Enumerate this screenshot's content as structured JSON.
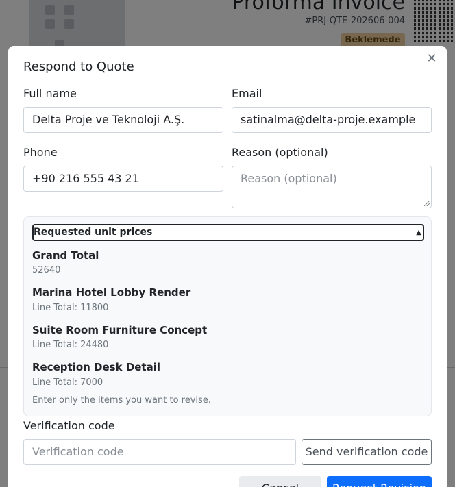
{
  "background": {
    "doc_title": "Proforma Invoice",
    "doc_ref": "#PRJ-QTE-202606-004",
    "status_badge": "Beklemede"
  },
  "modal": {
    "title": "Respond to Quote",
    "close_icon": "close-icon",
    "fields": {
      "full_name": {
        "label": "Full name",
        "value": "Delta Proje ve Teknoloji A.Ş."
      },
      "email": {
        "label": "Email",
        "value": "satinalma@delta-proje.example"
      },
      "phone": {
        "label": "Phone",
        "value": "+90 216 555 43 21"
      },
      "reason": {
        "label": "Reason (optional)",
        "placeholder": "Reason (optional)"
      }
    },
    "requested_prices": {
      "summary": "Requested unit prices",
      "items": [
        {
          "name": "Grand Total",
          "detail": "52640"
        },
        {
          "name": "Marina Hotel Lobby Render",
          "detail": "Line Total: 11800"
        },
        {
          "name": "Suite Room Furniture Concept",
          "detail": "Line Total: 24480"
        },
        {
          "name": "Reception Desk Detail",
          "detail": "Line Total: 7000"
        }
      ],
      "help": "Enter only the items you want to revise."
    },
    "verification": {
      "label": "Verification code",
      "placeholder": "Verification code",
      "send_button": "Send verification code"
    },
    "actions": {
      "cancel": "Cancel",
      "submit": "Request Revision"
    }
  }
}
